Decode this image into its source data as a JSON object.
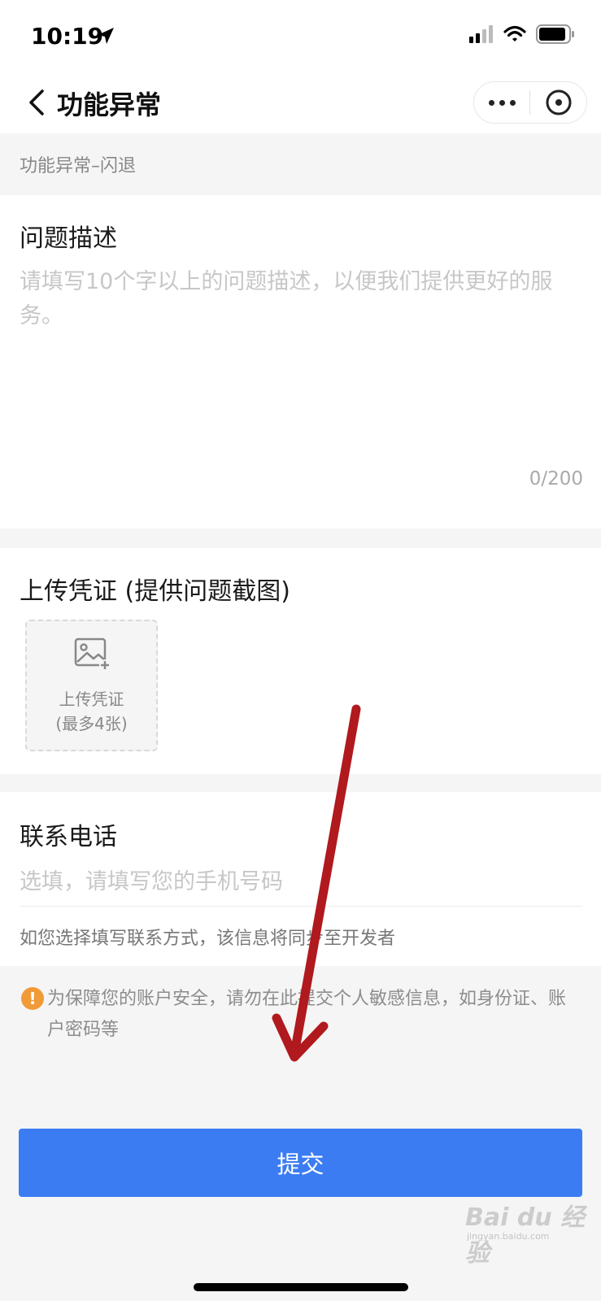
{
  "status_bar": {
    "time": "10:19"
  },
  "nav": {
    "title": "功能异常"
  },
  "category": "功能异常–闪退",
  "description": {
    "title": "问题描述",
    "placeholder": "请填写10个字以上的问题描述，以便我们提供更好的服务。",
    "count": "0/200"
  },
  "upload": {
    "title": "上传凭证 (提供问题截图)",
    "button_label": "上传凭证",
    "limit": "(最多4张)"
  },
  "contact": {
    "title": "联系电话",
    "placeholder": "选填，请填写您的手机号码",
    "hint": "如您选择填写联系方式，该信息将同步至开发者"
  },
  "warning": {
    "icon": "!",
    "text": "为保障您的账户安全，请勿在此提交个人敏感信息，如身份证、账户密码等"
  },
  "submit_label": "提交",
  "watermark": {
    "main": "Bai du 经验",
    "sub": "jingyan.baidu.com"
  },
  "colors": {
    "primary": "#3b7cf3",
    "warning": "#f19a38",
    "annotation_arrow": "#b0191d"
  },
  "icons": {
    "location": "location-arrow-icon",
    "signal": "cellular-signal-icon",
    "wifi": "wifi-icon",
    "battery": "battery-icon",
    "back": "chevron-left-icon",
    "more": "more-dots-icon",
    "close": "close-circle-icon",
    "upload": "image-add-icon"
  }
}
